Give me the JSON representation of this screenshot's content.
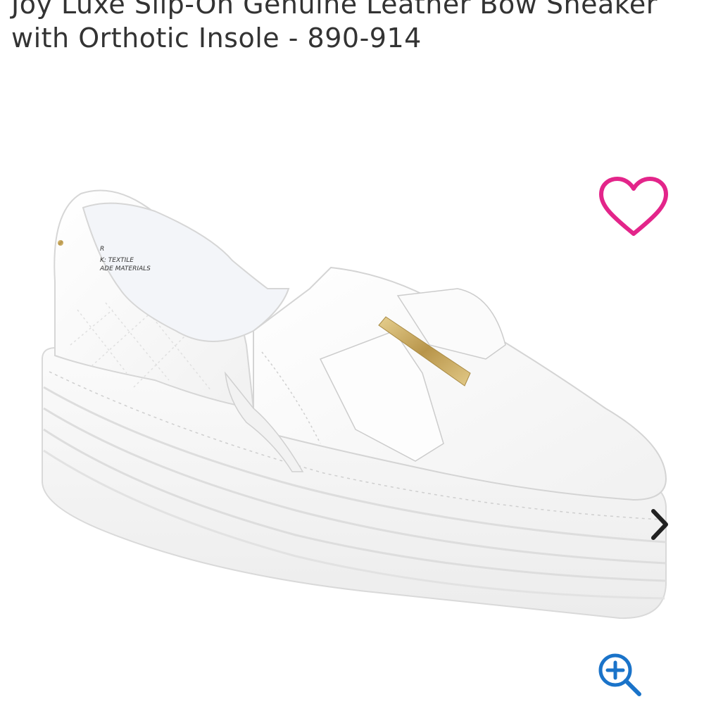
{
  "product": {
    "title_line1": "Joy Luxe Slip-On Genuine Leather Bow Sneaker",
    "title_line2": "with Orthotic Insole  - 890-914"
  },
  "image": {
    "alt": "White leather slip-on platform sneaker with bow and gold bar",
    "label_texts": [
      "R",
      "K: TEXTILE",
      "ADE MATERIALS"
    ]
  },
  "controls": {
    "favorite_icon": "heart-outline-icon",
    "next_icon": "chevron-right-icon",
    "zoom_icon": "zoom-in-icon"
  },
  "colors": {
    "accent": "#e3258a",
    "text": "#333333",
    "icon_blue": "#1a73c9",
    "gold": "#c9a95b"
  }
}
